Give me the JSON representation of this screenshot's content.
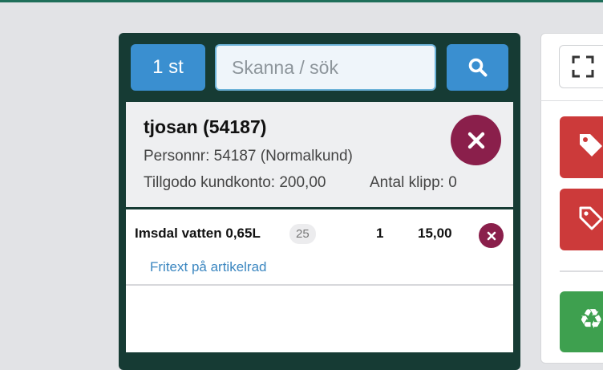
{
  "toolbar": {
    "qty_label": "1 st",
    "search_placeholder": "Skanna / sök"
  },
  "customer": {
    "name": "tjosan (54187)",
    "personnr": "Personnr: 54187 (Normalkund)",
    "credit": "Tillgodo kundkonto: 200,00",
    "clips": "Antal klipp: 0"
  },
  "articles": [
    {
      "name": "Imsdal vatten 0,65L",
      "badge": "25",
      "qty": "1",
      "price": "15,00",
      "fritext": "Fritext på artikelrad"
    }
  ],
  "icons": {
    "search": "search-icon",
    "remove": "close-icon",
    "fullscreen": "fullscreen-icon",
    "tag": "tag-icon",
    "tag_outline": "tag-outline-icon",
    "recycle": "recycle-icon"
  },
  "colors": {
    "primary": "#3a8fd0",
    "panel": "#163b34",
    "remove": "#8a1f4b",
    "danger": "#cc3a3a",
    "success": "#3ea04f",
    "link": "#3a86c0"
  }
}
